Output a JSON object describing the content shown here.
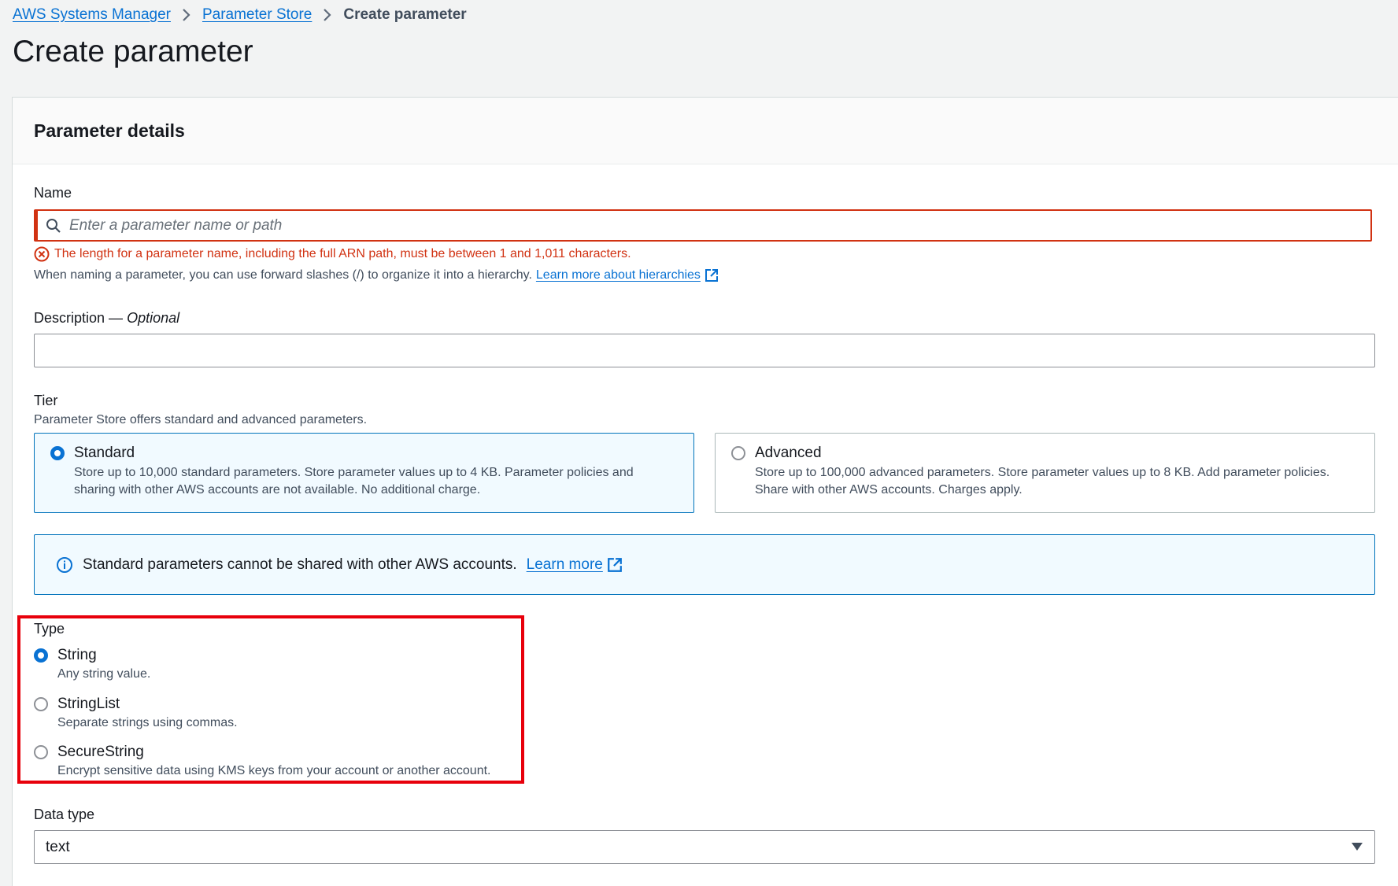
{
  "breadcrumb": {
    "items": [
      "AWS Systems Manager",
      "Parameter Store"
    ],
    "current": "Create parameter"
  },
  "page_title": "Create parameter",
  "panel": {
    "title": "Parameter details",
    "name": {
      "label": "Name",
      "placeholder": "Enter a parameter name or path",
      "value": "",
      "error": "The length for a parameter name, including the full ARN path, must be between 1 and 1,011 characters.",
      "hint": "When naming a parameter, you can use forward slashes (/) to organize it into a hierarchy.",
      "hint_link": "Learn more about hierarchies"
    },
    "description": {
      "label": "Description",
      "optional": "Optional",
      "value": ""
    },
    "tier": {
      "label": "Tier",
      "helper": "Parameter Store offers standard and advanced parameters.",
      "options": [
        {
          "label": "Standard",
          "desc_line1": "Store up to 10,000 standard parameters. Store parameter values up to 4 KB. Parameter policies and",
          "desc_line2": "sharing with other AWS accounts are not available. No additional charge.",
          "selected": true
        },
        {
          "label": "Advanced",
          "desc_line1": "Store up to 100,000 advanced parameters. Store parameter values up to 8 KB. Add parameter policies.",
          "desc_line2": "Share with other AWS accounts. Charges apply.",
          "selected": false
        }
      ]
    },
    "info": {
      "text": "Standard parameters cannot be shared with other AWS accounts.",
      "link": "Learn more"
    },
    "type": {
      "label": "Type",
      "options": [
        {
          "label": "String",
          "desc": "Any string value.",
          "selected": true
        },
        {
          "label": "StringList",
          "desc": "Separate strings using commas.",
          "selected": false
        },
        {
          "label": "SecureString",
          "desc": "Encrypt sensitive data using KMS keys from your account or another account.",
          "selected": false
        }
      ]
    },
    "data_type": {
      "label": "Data type",
      "value": "text"
    }
  },
  "colors": {
    "link": "#0972d3",
    "error": "#d13212",
    "highlight": "#e8000b",
    "selected_bg": "#f1faff"
  }
}
